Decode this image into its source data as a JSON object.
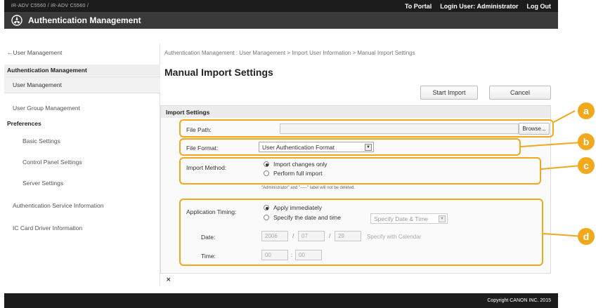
{
  "topbar": {
    "device": "iR-ADV C5560 / iR-ADV C5560 /",
    "to_portal": "To Portal",
    "login_user_label": "Login User:",
    "login_user_name": "Administrator",
    "log_out": "Log Out"
  },
  "app": {
    "title": "Authentication Management"
  },
  "sidebar": {
    "back": "←User Management",
    "section_auth": "Authentication Management",
    "user_management": "User Management",
    "user_group_management": "User Group Management",
    "preferences": "Preferences",
    "basic_settings": "Basic Settings",
    "control_panel_settings": "Control Panel Settings",
    "server_settings": "Server Settings",
    "auth_service_info": "Authentication Service Information",
    "ic_card_driver_info": "IC Card Driver Information"
  },
  "main": {
    "breadcrumb": "Authentication Management : User Management > Import User Information > Manual Import Settings",
    "page_title": "Manual Import Settings",
    "start_import": "Start Import",
    "cancel": "Cancel"
  },
  "import_settings": {
    "heading": "Import Settings",
    "file_path_label": "File Path:",
    "file_path_value": "",
    "browse": "Browse...",
    "file_format_label": "File Format:",
    "file_format_value": "User Authentication Format",
    "import_method_label": "Import Method:",
    "import_changes_only": "Import changes only",
    "perform_full_import": "Perform full import",
    "note": "\"Administrator\" and \"-----\" label will not be deleted.",
    "application_timing_label": "Application Timing:",
    "apply_immediately": "Apply immediately",
    "specify_date_time": "Specify the date and time",
    "specify_date_time_select": "Specify Date & Time",
    "date_label": "Date:",
    "date_year": "2006",
    "date_month": "07",
    "date_day": "29",
    "date_sep_1": "/",
    "date_sep_2": "/",
    "specify_with_calendar": "Specify with Calendar",
    "time_label": "Time:",
    "time_hour": "00",
    "time_minute": "00",
    "time_sep": ":"
  },
  "selected": {
    "import_method": "Import changes only",
    "application_timing": "Apply immediately"
  },
  "callouts": {
    "a": "a",
    "b": "b",
    "c": "c",
    "d": "d"
  },
  "collapse_icon": "⨯",
  "footer": {
    "copyright": "Copyright CANON INC. 2015"
  },
  "colors": {
    "accent": "#f0a81c",
    "topbar": "#1c1c1c",
    "titlebar": "#3a3a3a"
  }
}
